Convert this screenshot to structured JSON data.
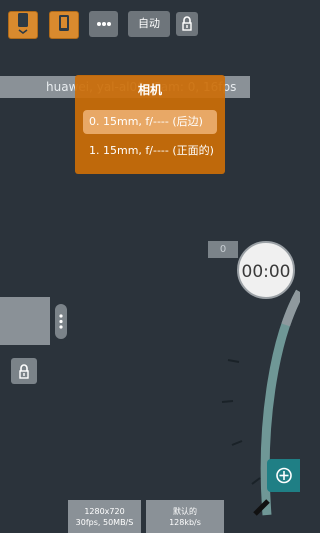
{
  "toolbar": {
    "mode_label": "自动",
    "icons": [
      "phone-rotate-icon",
      "phone-icon",
      "more-icon",
      "lock-icon"
    ]
  },
  "info_bar": {
    "text": "huawei, yal-al00, Cam: 0, 16fps"
  },
  "camera_panel": {
    "title": "相机",
    "options": [
      "0. 15mm, f/---- (后边)",
      "1. 15mm, f/---- (正面的)"
    ],
    "selected_index": 0
  },
  "counter": {
    "value": "0"
  },
  "timer": {
    "value": "00:00"
  },
  "bottom": {
    "resolution_line1": "1280x720",
    "resolution_line2": "30fps, 50MB/S",
    "audio_line1": "默认的",
    "audio_line2": "128kb/s"
  },
  "colors": {
    "accent_orange": "#d98a2e",
    "panel_orange": "#cc6e08",
    "teal": "#1f7f85",
    "background": "#2b333b"
  }
}
